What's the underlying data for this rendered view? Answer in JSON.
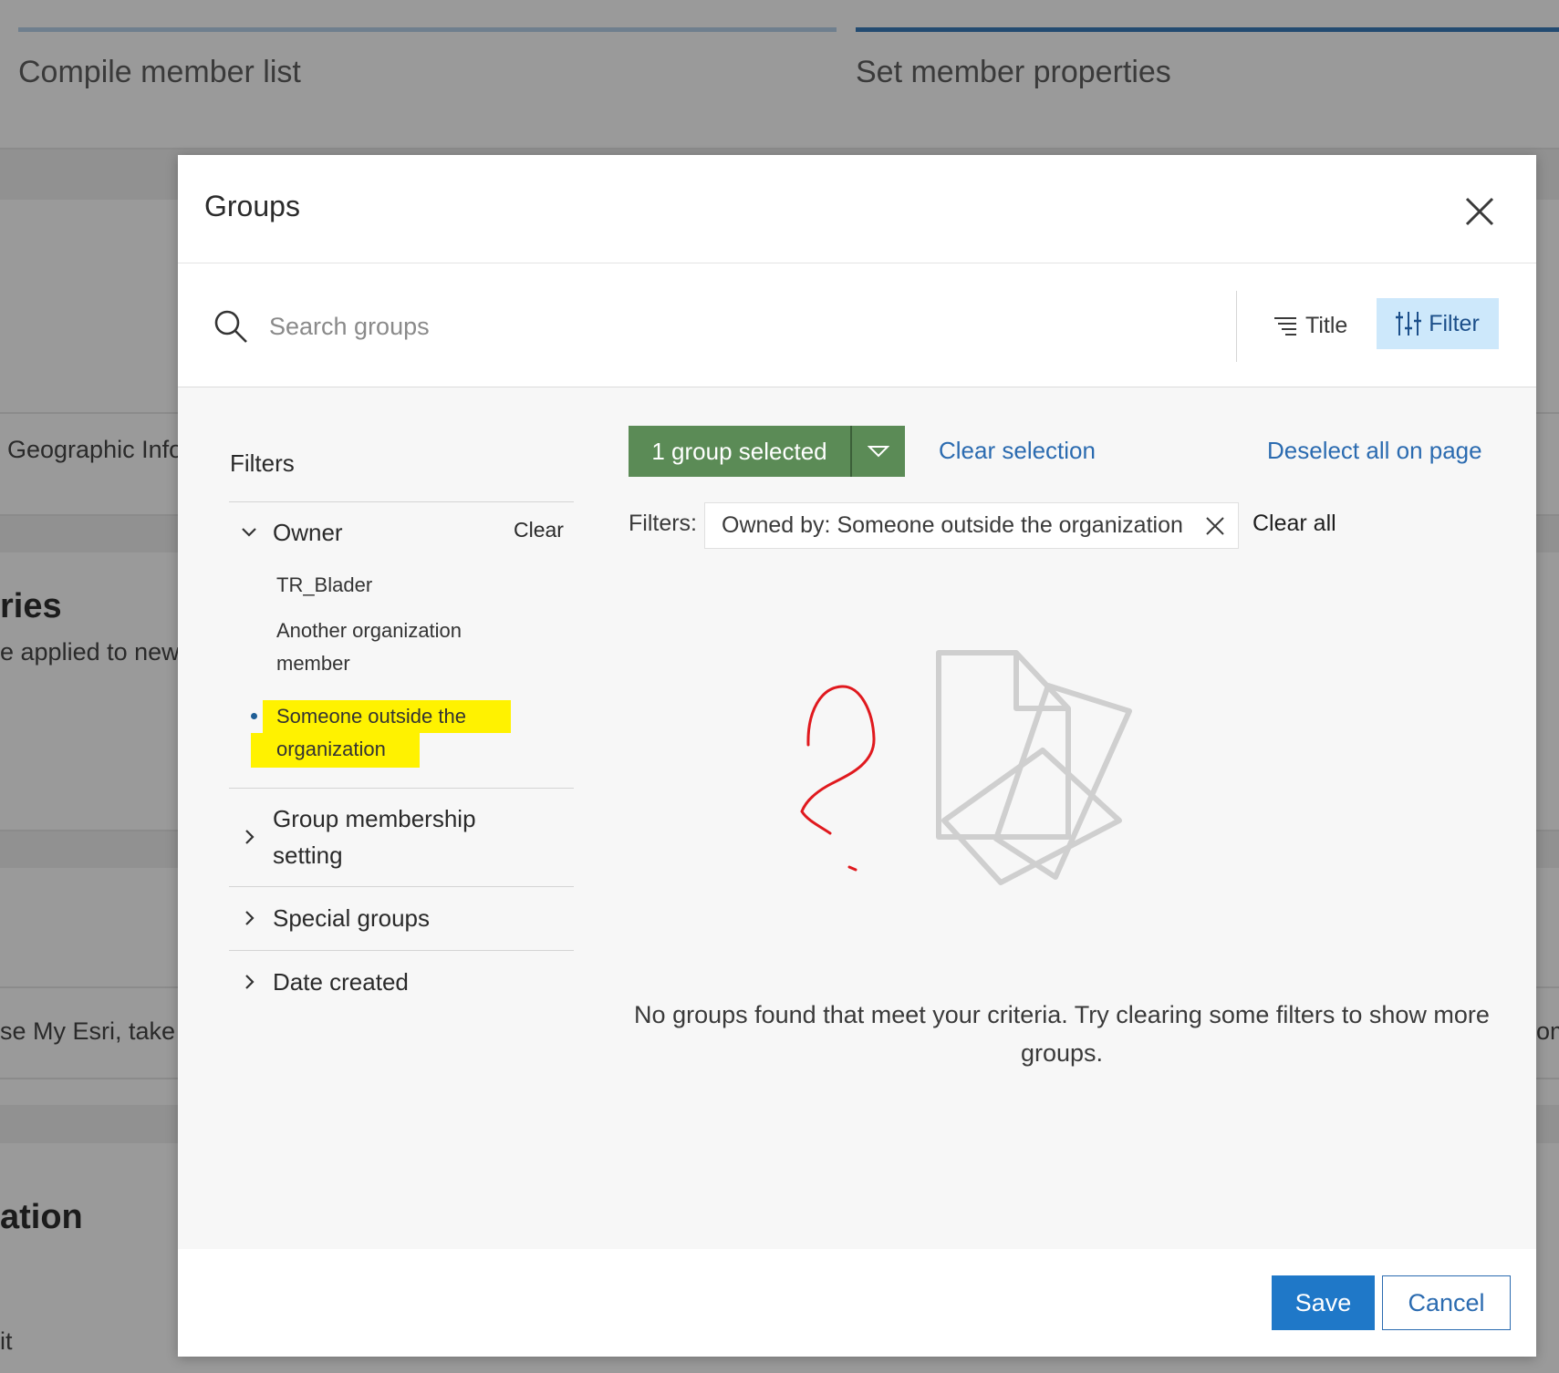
{
  "background": {
    "steps": [
      "Compile member list",
      "Set member properties"
    ],
    "fragments": {
      "geographic": "Geographic Info",
      "ries": "ries",
      "applied": "e applied to new",
      "esri": "se My Esri, take",
      "right_fragment": "om",
      "ation": "ation",
      "it": "it"
    }
  },
  "modal": {
    "title": "Groups",
    "search_placeholder": "Search groups",
    "sort_label": "Title",
    "filter_label": "Filter"
  },
  "filters_panel": {
    "title": "Filters",
    "owner": {
      "label": "Owner",
      "clear_label": "Clear",
      "options": [
        "TR_Blader",
        "Another organization member",
        "Someone outside the organization"
      ],
      "selected": "Someone outside the organization"
    },
    "sections": [
      "Group membership setting",
      "Special groups",
      "Date created"
    ]
  },
  "results": {
    "selection_label": "1 group selected",
    "clear_selection": "Clear selection",
    "deselect_all": "Deselect all on page",
    "filters_prefix": "Filters:",
    "active_filter": "Owned by: Someone outside the organization",
    "clear_all": "Clear all",
    "empty_message": "No groups found that meet your criteria. Try clearing some filters to show more groups."
  },
  "footer": {
    "save_label": "Save",
    "cancel_label": "Cancel"
  },
  "colors": {
    "primary": "#1f78c8",
    "selection_green": "#5b8b56",
    "highlight": "#fff200",
    "annotation_red": "#e0191e"
  }
}
